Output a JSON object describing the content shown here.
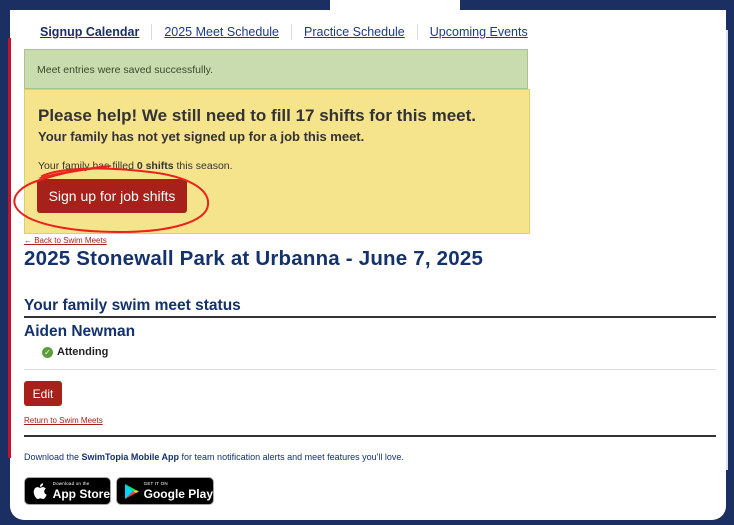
{
  "tabs": [
    {
      "label": "Signup Calendar"
    },
    {
      "label": "2025 Meet Schedule"
    },
    {
      "label": "Practice Schedule"
    },
    {
      "label": "Upcoming Events"
    }
  ],
  "alerts": {
    "success": "Meet entries were saved successfully.",
    "warning_title": "Please help! We still need to fill 17 shifts for this meet.",
    "warning_sub": "Your family has not yet signed up for a job this meet.",
    "filled_prefix": "Your family has filled ",
    "filled_count": "0 shifts",
    "filled_suffix": " this season.",
    "signup_button": "Sign up for job shifts"
  },
  "meet": {
    "back_link": "← Back to Swim Meets",
    "title": "2025 Stonewall Park at Urbanna - June 7, 2025"
  },
  "status": {
    "section_title": "Your family swim meet status",
    "swimmer_name": "Aiden Newman",
    "attendance": "Attending",
    "edit_button": "Edit",
    "return_link": "Return to Swim Meets"
  },
  "download": {
    "prefix": "Download the ",
    "app_name": "SwimTopia Mobile App",
    "suffix": " for team notification alerts and meet features you'll love.",
    "appstore_small": "Download on the",
    "appstore_big": "App Store",
    "googleplay_small": "GET IT ON",
    "googleplay_big": "Google Play"
  },
  "colors": {
    "navy": "#1b2f63",
    "title_blue": "#14326b",
    "button_red": "#a8201a",
    "success_green": "#c9dcaf",
    "warning_yellow": "#f6e48c",
    "annotation_red": "#e8231e"
  }
}
